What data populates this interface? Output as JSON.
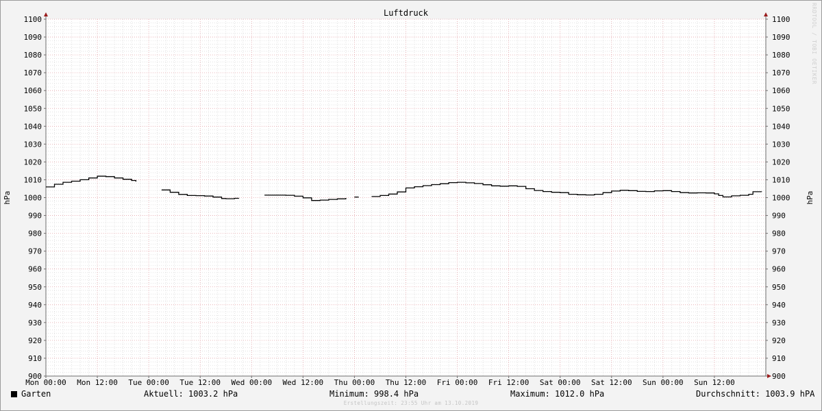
{
  "chart_data": {
    "type": "line",
    "title": "Luftdruck",
    "ylabel": "hPa",
    "y_right_label": "hPa",
    "xlabel": "",
    "ylim": [
      900,
      1100
    ],
    "y_ticks": [
      "900",
      "910",
      "920",
      "930",
      "940",
      "950",
      "960",
      "970",
      "980",
      "990",
      "1000",
      "1010",
      "1020",
      "1030",
      "1040",
      "1050",
      "1060",
      "1070",
      "1080",
      "1090",
      "1100"
    ],
    "xlim": [
      0,
      168
    ],
    "x_ticks": [
      {
        "h": 0,
        "label": "Mon 00:00"
      },
      {
        "h": 12,
        "label": "Mon 12:00"
      },
      {
        "h": 24,
        "label": "Tue 00:00"
      },
      {
        "h": 36,
        "label": "Tue 12:00"
      },
      {
        "h": 48,
        "label": "Wed 00:00"
      },
      {
        "h": 60,
        "label": "Wed 12:00"
      },
      {
        "h": 72,
        "label": "Thu 00:00"
      },
      {
        "h": 84,
        "label": "Thu 12:00"
      },
      {
        "h": 96,
        "label": "Fri 00:00"
      },
      {
        "h": 108,
        "label": "Fri 12:00"
      },
      {
        "h": 120,
        "label": "Sat 00:00"
      },
      {
        "h": 132,
        "label": "Sat 12:00"
      },
      {
        "h": 144,
        "label": "Sun 00:00"
      },
      {
        "h": 156,
        "label": "Sun 12:00"
      }
    ],
    "grid": true,
    "series": [
      {
        "name": "Garten",
        "color": "#000000",
        "segments": [
          [
            [
              0,
              1006.0
            ],
            [
              2,
              1007.5
            ],
            [
              4,
              1008.6
            ],
            [
              6,
              1009.2
            ],
            [
              8,
              1010.0
            ],
            [
              10,
              1011.0
            ],
            [
              12,
              1012.0
            ],
            [
              14,
              1011.8
            ],
            [
              16,
              1011.0
            ],
            [
              18,
              1010.3
            ],
            [
              20,
              1009.6
            ],
            [
              21,
              1009.0
            ]
          ],
          [
            [
              27,
              1004.3
            ],
            [
              29,
              1003.0
            ],
            [
              31,
              1001.8
            ],
            [
              33,
              1001.2
            ],
            [
              35,
              1001.1
            ],
            [
              37,
              1000.9
            ],
            [
              39,
              1000.3
            ],
            [
              41,
              999.5
            ],
            [
              42,
              999.4
            ],
            [
              44,
              999.6
            ],
            [
              45,
              999.7
            ]
          ],
          [
            [
              51,
              1001.4
            ],
            [
              54,
              1001.4
            ],
            [
              56,
              1001.3
            ],
            [
              58,
              1000.8
            ],
            [
              60,
              999.9
            ],
            [
              62,
              998.4
            ],
            [
              64,
              998.6
            ],
            [
              66,
              999.0
            ],
            [
              68,
              999.3
            ],
            [
              70,
              999.8
            ]
          ],
          [
            [
              72,
              1000.3
            ],
            [
              73,
              1000.3
            ]
          ],
          [
            [
              76,
              1000.6
            ],
            [
              78,
              1001.2
            ],
            [
              80,
              1002.0
            ],
            [
              82,
              1003.2
            ],
            [
              84,
              1005.4
            ],
            [
              86,
              1006.1
            ],
            [
              88,
              1006.7
            ],
            [
              90,
              1007.3
            ],
            [
              92,
              1007.8
            ],
            [
              94,
              1008.4
            ],
            [
              96,
              1008.6
            ],
            [
              98,
              1008.3
            ],
            [
              100,
              1007.9
            ],
            [
              102,
              1007.2
            ],
            [
              104,
              1006.6
            ],
            [
              106,
              1006.4
            ],
            [
              108,
              1006.6
            ],
            [
              110,
              1006.3
            ],
            [
              112,
              1005.0
            ],
            [
              114,
              1004.0
            ],
            [
              116,
              1003.4
            ],
            [
              118,
              1003.0
            ],
            [
              120,
              1002.8
            ],
            [
              122,
              1001.9
            ],
            [
              124,
              1001.6
            ],
            [
              126,
              1001.5
            ],
            [
              128,
              1001.9
            ],
            [
              130,
              1002.8
            ],
            [
              132,
              1003.7
            ],
            [
              134,
              1004.1
            ],
            [
              136,
              1003.9
            ],
            [
              138,
              1003.5
            ],
            [
              140,
              1003.4
            ],
            [
              142,
              1003.8
            ],
            [
              144,
              1003.9
            ],
            [
              146,
              1003.4
            ],
            [
              148,
              1002.8
            ],
            [
              150,
              1002.6
            ],
            [
              152,
              1002.7
            ],
            [
              154,
              1002.6
            ],
            [
              156,
              1002.1
            ],
            [
              157,
              1001.2
            ],
            [
              158,
              1000.4
            ],
            [
              160,
              1001.0
            ],
            [
              162,
              1001.3
            ],
            [
              164,
              1001.9
            ],
            [
              165,
              1003.3
            ],
            [
              167,
              1003.2
            ]
          ]
        ]
      }
    ]
  },
  "legend": {
    "name": "Garten",
    "aktuell": "Aktuell: 1003.2 hPa",
    "minimum": "Minimum: 998.4 hPa",
    "maximum": "Maximum: 1012.0 hPa",
    "durchschnitt": "Durchschnitt: 1003.9 hPA"
  },
  "footer": "Erstellungszeit: 23:55 Uhr am 13.10.2019",
  "watermark": "RRDTOOL / TOBI OETIKER",
  "colors": {
    "background": "#f3f3f3",
    "plot_background": "#ffffff",
    "major_grid": "#e3a0a6",
    "minor_grid": "#cfcfcf",
    "axis": "#6e6e6e",
    "arrow": "#9a1c1c"
  }
}
